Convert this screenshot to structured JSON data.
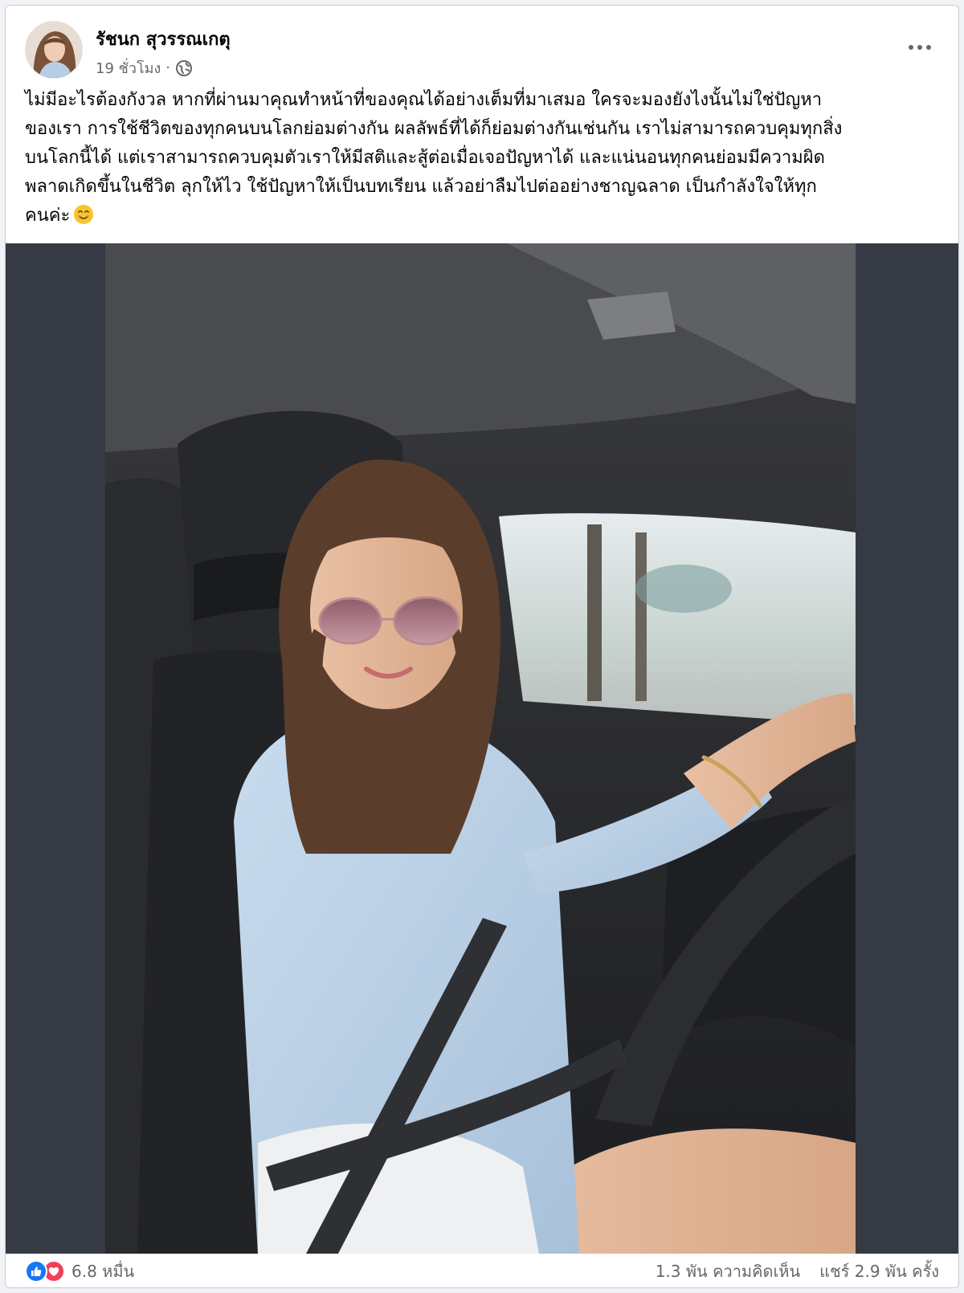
{
  "post": {
    "author": "รัชนก สุวรรณเกตุ",
    "time": "19 ชั่วโมง",
    "separator": "·",
    "audience_icon": "globe-icon",
    "more_icon": "more-options-icon",
    "text_lines": [
      "ไม่มีอะไรต้องกังวล หากที่ผ่านมาคุณทำหน้าที่ของคุณได้อย่างเต็มที่มาเสมอ ใครจะมองยังไงนั้นไม่ใช่ปัญหา",
      "ของเรา การใช้ชีวิตของทุกคนบนโลกย่อมต่างกัน ผลลัพธ์ที่ได้ก็ย่อมต่างกันเช่นกัน เราไม่สามารถควบคุมทุกสิ่ง",
      "บนโลกนี้ได้ แต่เราสามารถควบคุมตัวเราให้มีสติและสู้ต่อเมื่อเจอปัญหาได้ และแน่นอนทุกคนย่อมมีความผิด",
      "พลาดเกิดขึ้นในชีวิต ลุกให้ไว ใช้ปัญหาให้เป็นบทเรียน แล้วอย่าลืมไปต่ออย่างชาญฉลาด เป็นกำลังใจให้ทุก",
      "คนค่ะ"
    ],
    "text_emoji": "smiling-face-emoji"
  },
  "footer": {
    "reaction_icons": [
      "like-icon",
      "love-icon"
    ],
    "reactions_count": "6.8 หมื่น",
    "comments": "1.3 พัน ความคิดเห็น",
    "shares": "แชร์ 2.9 พัน ครั้ง"
  },
  "colors": {
    "like": "#1877f2",
    "love": "#f33e58",
    "secondary_text": "#65676b",
    "media_background": "#353a44"
  }
}
